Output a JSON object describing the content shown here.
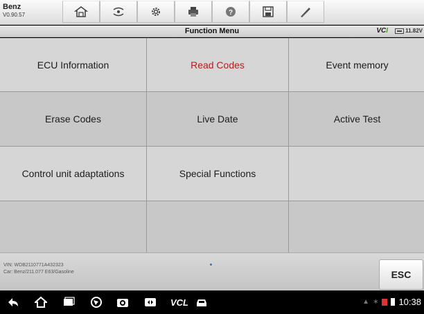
{
  "header": {
    "brand": "Benz",
    "version": "V0.90.57",
    "tools": [
      "home",
      "vehicle-swap",
      "settings",
      "print",
      "help",
      "save",
      "edit"
    ]
  },
  "titlebar": {
    "title": "Function Menu",
    "vci_prefix": "VC",
    "vci_suffix": "I",
    "voltage": "11.82V"
  },
  "menu": {
    "items": [
      "ECU Information",
      "Read Codes",
      "Event memory",
      "Erase Codes",
      "Live Date",
      "Active Test",
      "Control unit adaptations",
      "Special Functions",
      "",
      "",
      "",
      ""
    ],
    "active_index": 1
  },
  "footer": {
    "vin": "VIN: WDB2110771A432323",
    "car": "Car: Benz/211.077 E63/Gasoline",
    "esc_label": "ESC"
  },
  "navbar": {
    "vcl_label": "VCL",
    "time": "10:38"
  },
  "colors": {
    "active_text": "#b21d1d",
    "vci_accent": "#4a9a1f"
  }
}
